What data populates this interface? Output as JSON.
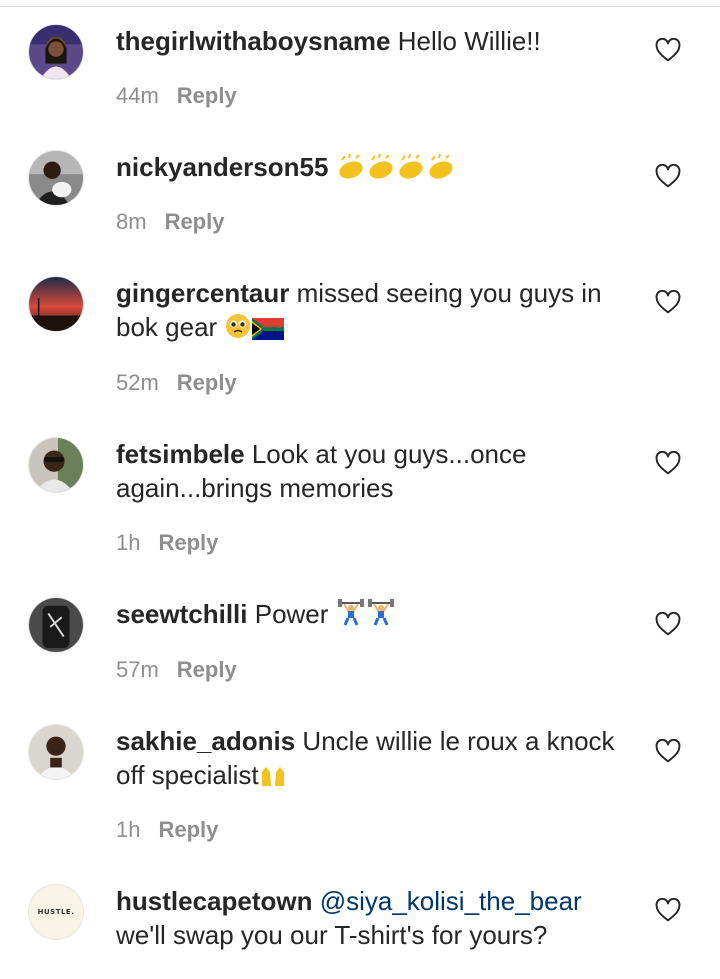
{
  "comments": [
    {
      "username": "thegirlwithaboysname",
      "text": " Hello Willie!!",
      "time": "44m",
      "reply": "Reply",
      "emoji": []
    },
    {
      "username": "nickyanderson55",
      "text": " ",
      "time": "8m",
      "reply": "Reply",
      "emoji": [
        "clap",
        "clap",
        "clap",
        "clap"
      ]
    },
    {
      "username": "gingercentaur",
      "text": " missed seeing you guys in bok gear ",
      "time": "52m",
      "reply": "Reply",
      "emoji": [
        "pleading-face",
        "south-africa-flag"
      ]
    },
    {
      "username": "fetsimbele",
      "text": " Look at you guys...once again...brings memories",
      "time": "1h",
      "reply": "Reply",
      "emoji": []
    },
    {
      "username": "seewtchilli",
      "text": " Power ",
      "time": "57m",
      "reply": "Reply",
      "emoji": [
        "weightlifter",
        "weightlifter"
      ]
    },
    {
      "username": "sakhie_adonis",
      "text": " Uncle willie le roux a knock off specialist",
      "time": "1h",
      "reply": "Reply",
      "emoji": [
        "raising-hands"
      ]
    },
    {
      "username": "hustlecapetown",
      "mention": " @siya_kolisi_the_bear",
      "text": " we'll swap you our T-shirt's for yours?",
      "time": "",
      "reply": "",
      "emoji": [],
      "avatar_text": "HUSTLE."
    }
  ],
  "colors": {
    "text": "#262626",
    "meta": "#8e8e8e",
    "mention": "#00376b"
  },
  "icons": {
    "like": "heart-outline-icon"
  }
}
